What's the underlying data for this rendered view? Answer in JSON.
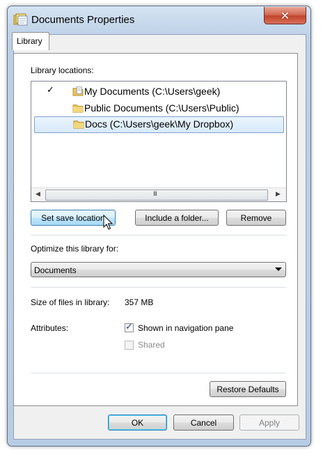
{
  "window": {
    "title": "Documents Properties",
    "close_glyph": "✕"
  },
  "tabs": [
    {
      "label": "Library",
      "selected": true
    }
  ],
  "library_locations": {
    "label": "Library locations:",
    "items": [
      {
        "check": "✓",
        "text": "My Documents (C:\\Users\\geek)",
        "icon": "library-folder-icon",
        "is_save_location": true
      },
      {
        "check": "",
        "text": "Public Documents (C:\\Users\\Public)",
        "icon": "folder-icon",
        "is_save_location": false
      },
      {
        "check": "",
        "text": "Docs (C:\\Users\\geek\\My Dropbox)",
        "icon": "folder-icon",
        "selected": true
      }
    ],
    "scroll_left": "◀",
    "scroll_right": "▶",
    "scroll_grip": "III"
  },
  "buttons": {
    "set_save_location": "Set save location",
    "include_folder": "Include a folder...",
    "remove": "Remove",
    "restore_defaults": "Restore Defaults",
    "ok": "OK",
    "cancel": "Cancel",
    "apply": "Apply"
  },
  "optimize": {
    "label": "Optimize this library for:",
    "selected": "Documents"
  },
  "size": {
    "label": "Size of files in library:",
    "value": "357 MB"
  },
  "attributes": {
    "label": "Attributes:",
    "shown_in_navigation_pane": {
      "label": "Shown in navigation pane",
      "checked": true
    },
    "shared": {
      "label": "Shared",
      "checked": false,
      "disabled": true
    }
  },
  "colors": {
    "selection_border": "#7da2ce",
    "hot_button_border": "#3c7fb1",
    "close_button": "#c3442b"
  }
}
